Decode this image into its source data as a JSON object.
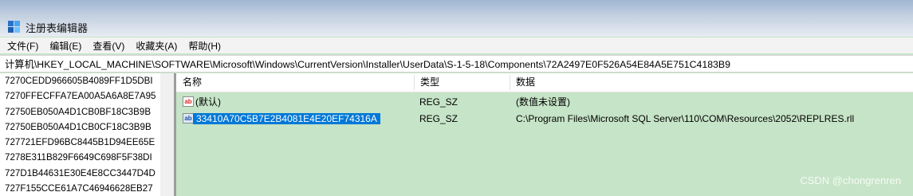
{
  "window": {
    "title": "注册表编辑器",
    "app_icon": "regedit-icon"
  },
  "menu": [
    "文件(F)",
    "编辑(E)",
    "查看(V)",
    "收藏夹(A)",
    "帮助(H)"
  ],
  "address": "计算机\\HKEY_LOCAL_MACHINE\\SOFTWARE\\Microsoft\\Windows\\CurrentVersion\\Installer\\UserData\\S-1-5-18\\Components\\72A2497E0F526A54E84A5E751C4183B9",
  "tree": [
    "7270CEDD966605B4089FF1D5DBI",
    "7270FFECFFA7EA00A5A6A8E7A95",
    "72750EB050A4D1CB0BF18C3B9B",
    "72750EB050A4D1CB0CF18C3B9B",
    "727721EFD96BC8445B1D94EE65E",
    "7278E311B829F6649C698F5F38DI",
    "727D1B44631E30E4E8CC3447D4D",
    "727F155CCE61A7C46946628EB27"
  ],
  "list": {
    "headers": {
      "name": "名称",
      "type": "类型",
      "data": "数据"
    },
    "rows": [
      {
        "icon": "string-value-icon",
        "name": "(默认)",
        "type": "REG_SZ",
        "data": "(数值未设置)",
        "selected": false
      },
      {
        "icon": "string-value-icon",
        "name": "33410A70C5B7E2B4081E4E20EF74316A",
        "type": "REG_SZ",
        "data": "C:\\Program Files\\Microsoft SQL Server\\110\\COM\\Resources\\2052\\REPLRES.rll",
        "selected": true
      }
    ]
  },
  "watermark": "CSDN @chongrenren",
  "colors": {
    "list_background": "#c6e4c7",
    "selection": "#0078d7"
  }
}
